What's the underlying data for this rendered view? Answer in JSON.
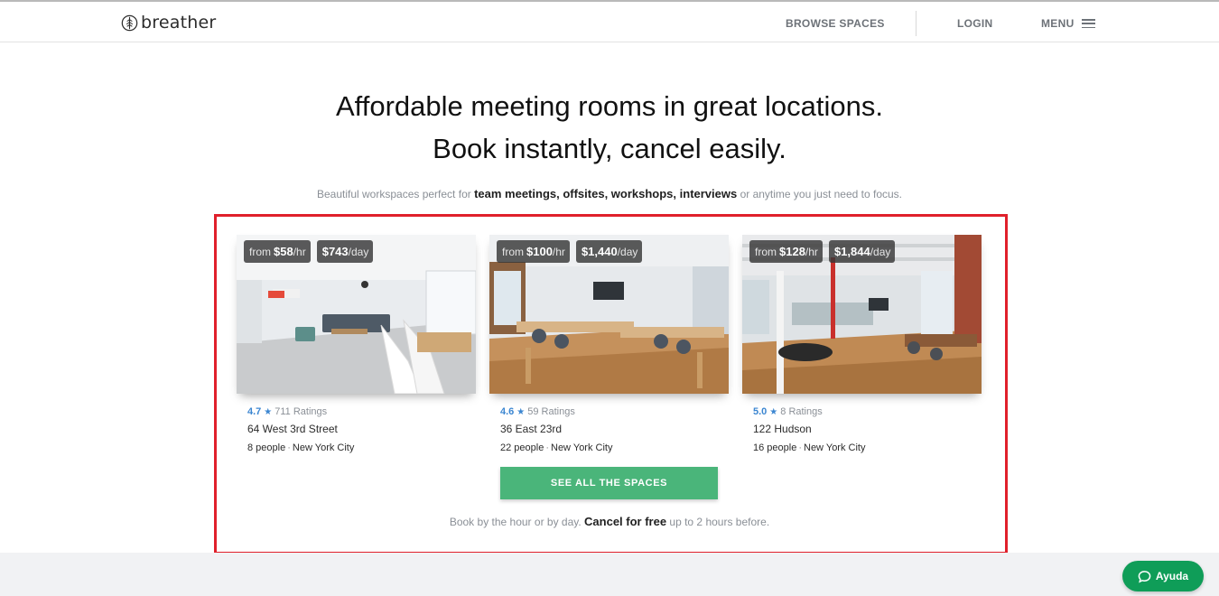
{
  "header": {
    "logo_text": "breather",
    "nav": {
      "browse": "BROWSE SPACES",
      "login": "LOGIN",
      "menu": "MENU"
    }
  },
  "hero": {
    "line1": "Affordable meeting rooms in great locations.",
    "line2": "Book instantly, cancel easily."
  },
  "subtitle": {
    "prefix": "Beautiful workspaces perfect for ",
    "highlight": "team meetings, offsites, workshops, interviews",
    "suffix": " or anytime you just need to focus."
  },
  "cards": [
    {
      "hourly_prefix": "from",
      "hourly_amount": "$58",
      "hourly_suffix": "/hr",
      "daily_amount": "$743",
      "daily_suffix": "/day",
      "rating": "4.7",
      "ratings_count": "711 Ratings",
      "address": "64 West 3rd Street",
      "capacity": "8 people",
      "city": "New York City"
    },
    {
      "hourly_prefix": "from",
      "hourly_amount": "$100",
      "hourly_suffix": "/hr",
      "daily_amount": "$1,440",
      "daily_suffix": "/day",
      "rating": "4.6",
      "ratings_count": "59 Ratings",
      "address": "36 East 23rd",
      "capacity": "22 people",
      "city": "New York City"
    },
    {
      "hourly_prefix": "from",
      "hourly_amount": "$128",
      "hourly_suffix": "/hr",
      "daily_amount": "$1,844",
      "daily_suffix": "/day",
      "rating": "5.0",
      "ratings_count": "8 Ratings",
      "address": "122 Hudson",
      "capacity": "16 people",
      "city": "New York City"
    }
  ],
  "cta": {
    "label": "SEE ALL THE SPACES"
  },
  "footnote": {
    "prefix": "Book by the hour or by day. ",
    "highlight": "Cancel for free",
    "suffix": " up to 2 hours before."
  },
  "help_button": {
    "label": "Ayuda"
  },
  "colors": {
    "accent_green": "#4ab57a",
    "rating_blue": "#3b86d1",
    "highlight_red": "#e0202b",
    "help_green": "#0f9d58"
  },
  "icons": {
    "logo": "tree-logo-icon",
    "menu": "hamburger-icon",
    "rating": "star-icon",
    "help": "chat-bubble-icon"
  }
}
